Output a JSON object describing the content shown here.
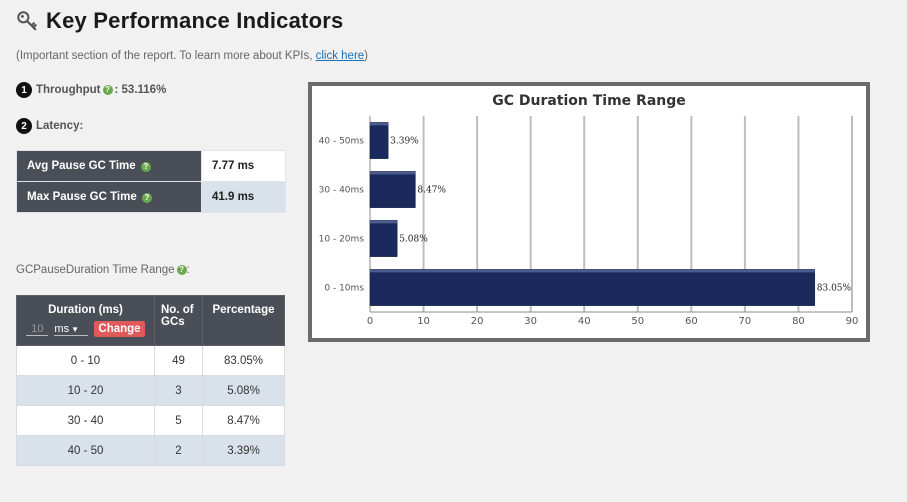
{
  "header": {
    "title": "Key Performance Indicators",
    "subtitle": "(Important section of the report. To learn more about KPIs,",
    "link_text": "click here",
    "subtitle_end": ")"
  },
  "kpi": {
    "throughput_num": "1",
    "throughput_label": "Throughput",
    "throughput_value": ": 53.116%",
    "latency_num": "2",
    "latency_label": "Latency:",
    "help_glyph": "?"
  },
  "latency_table": [
    {
      "label": "Avg Pause GC Time",
      "value": "7.77 ms"
    },
    {
      "label": "Max Pause GC Time",
      "value": "41.9 ms"
    }
  ],
  "range_section": {
    "label": "GCPauseDuration Time Range",
    "colon": ":"
  },
  "duration_table": {
    "headers": {
      "duration": "Duration (ms)",
      "count": "No. of GCs",
      "percentage": "Percentage"
    },
    "unit_input_value": "10",
    "unit_select_value": "ms",
    "change_button": "Change",
    "rows": [
      {
        "range": "0 - 10",
        "count": "49",
        "pct": "83.05%"
      },
      {
        "range": "10 - 20",
        "count": "3",
        "pct": "5.08%"
      },
      {
        "range": "30 - 40",
        "count": "5",
        "pct": "8.47%"
      },
      {
        "range": "40 - 50",
        "count": "2",
        "pct": "3.39%"
      }
    ]
  },
  "chart_data": {
    "type": "bar",
    "orientation": "horizontal",
    "title": "GC Duration Time Range",
    "categories": [
      "40 - 50ms",
      "30 - 40ms",
      "10 - 20ms",
      "0 - 10ms"
    ],
    "values": [
      3.39,
      8.47,
      5.08,
      83.05
    ],
    "labels": [
      "3.39%",
      "8.47%",
      "5.08%",
      "83.05%"
    ],
    "xlim": [
      0,
      90
    ],
    "xticks": [
      0,
      10,
      20,
      30,
      40,
      50,
      60,
      70,
      80,
      90
    ],
    "grid": true,
    "bar_color": "#1b2a5c"
  },
  "colors": {
    "header_bg": "#4a4f57",
    "help_green": "#6aa84f",
    "change_red": "#e05a5a"
  },
  "icons": {
    "title_icon": "key-icon",
    "help_icon": "question-circle-icon",
    "dropdown_icon": "caret-down-icon"
  }
}
